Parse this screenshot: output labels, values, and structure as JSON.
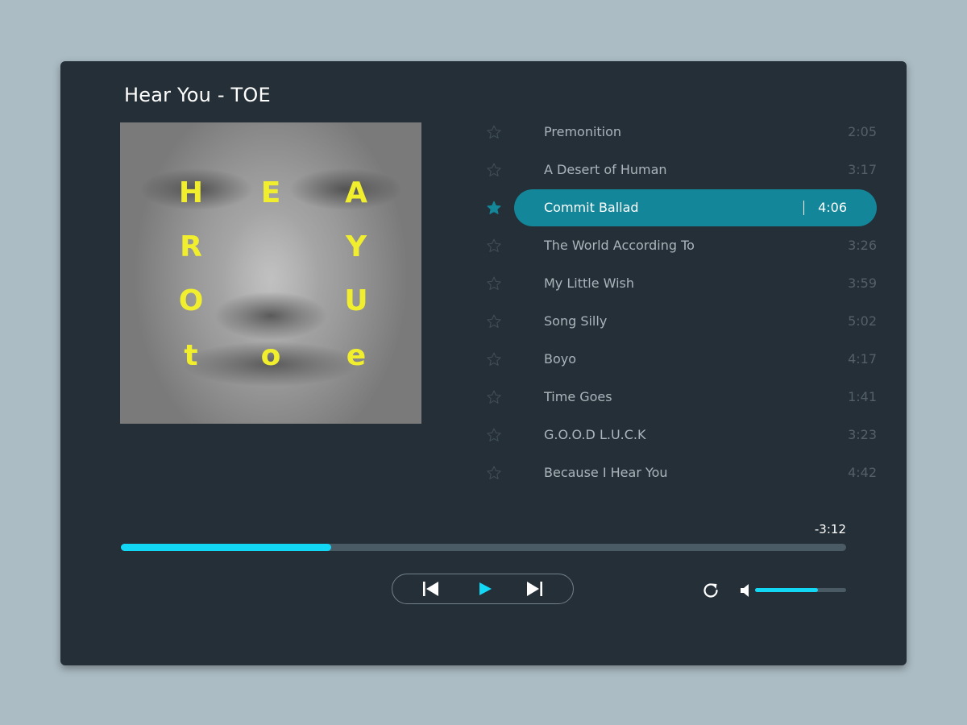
{
  "now_playing": {
    "song": "Hear You",
    "separator": " - ",
    "artist": "TOE"
  },
  "cover_letters": [
    "H",
    "E",
    "A",
    "R",
    "Y",
    "O",
    "U",
    "t",
    "o",
    "e"
  ],
  "tracks": [
    {
      "title": "Premonition",
      "duration": "2:05",
      "starred": false,
      "active": false
    },
    {
      "title": "A Desert of Human",
      "duration": "3:17",
      "starred": false,
      "active": false
    },
    {
      "title": "Commit Ballad",
      "duration": "4:06",
      "starred": true,
      "active": true
    },
    {
      "title": "The World According To",
      "duration": "3:26",
      "starred": false,
      "active": false
    },
    {
      "title": "My Little Wish",
      "duration": "3:59",
      "starred": false,
      "active": false
    },
    {
      "title": "Song Silly",
      "duration": "5:02",
      "starred": false,
      "active": false
    },
    {
      "title": "Boyo",
      "duration": "4:17",
      "starred": false,
      "active": false
    },
    {
      "title": "Time Goes",
      "duration": "1:41",
      "starred": false,
      "active": false
    },
    {
      "title": "G.O.O.D L.U.C.K",
      "duration": "3:23",
      "starred": false,
      "active": false
    },
    {
      "title": "Because I Hear You",
      "duration": "4:42",
      "starred": false,
      "active": false
    }
  ],
  "playback": {
    "remaining": "-3:12",
    "progress_fraction": 0.29,
    "volume_fraction": 0.69
  },
  "controls": {
    "prev_icon": "skip-previous-icon",
    "play_icon": "play-icon",
    "next_icon": "skip-next-icon",
    "repeat_icon": "repeat-icon",
    "volume_icon": "speaker-icon"
  },
  "colors": {
    "accent": "#12d8f6",
    "active_row": "#13869a",
    "panel": "#252f37",
    "background": "#acbcc4",
    "cover_text": "#f1ef2d"
  }
}
